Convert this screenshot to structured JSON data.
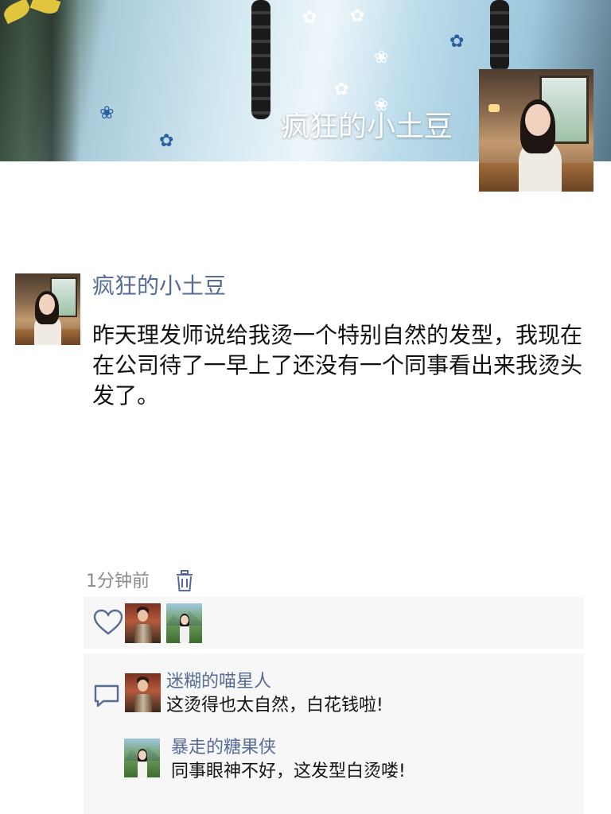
{
  "cover": {
    "title": "疯狂的小土豆"
  },
  "post": {
    "author": "疯狂的小土豆",
    "content": "昨天理发师说给我烫一个特别自然的发型，我现在在公司待了一早上了还没有一个同事看出来我烫头发了。",
    "time": "1分钟前"
  },
  "comments": [
    {
      "author": "迷糊的喵星人",
      "text": "这烫得也太自然，白花钱啦!"
    },
    {
      "author": "暴走的糖果侠",
      "text": "同事眼神不好，这发型白烫喽!"
    }
  ],
  "icons": {
    "delete": "trash-icon",
    "like": "heart-icon",
    "comment": "comment-icon"
  },
  "colors": {
    "name_link": "#576b95",
    "panel_bg": "#f7f7f7",
    "time_text": "#8a8a8a"
  }
}
